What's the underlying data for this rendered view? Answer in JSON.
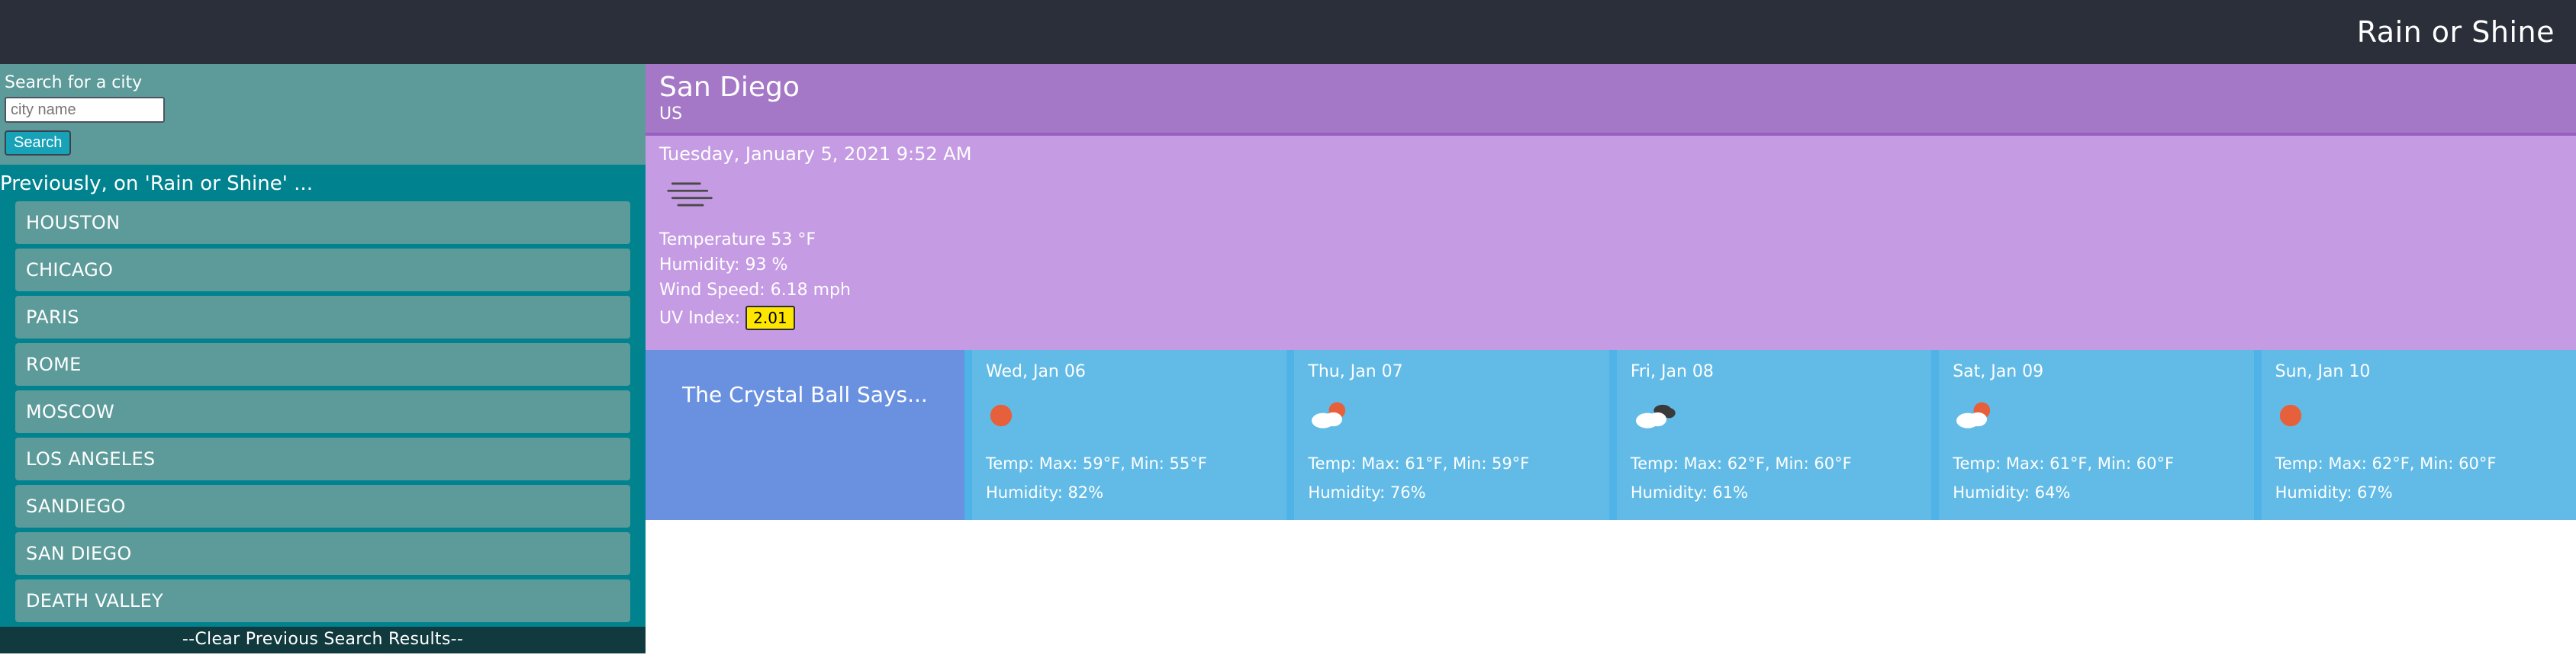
{
  "app": {
    "title": "Rain or Shine"
  },
  "sidebar": {
    "search_label": "Search for a city",
    "placeholder": "city name",
    "search_button": "Search",
    "history_title": "Previously, on 'Rain or Shine' ...",
    "history": [
      "HOUSTON",
      "CHICAGO",
      "PARIS",
      "ROME",
      "MOSCOW",
      "LOS ANGELES",
      "SANDIEGO",
      "SAN DIEGO",
      "DEATH VALLEY"
    ],
    "clear_label": "--Clear Previous Search Results--"
  },
  "current": {
    "city": "San Diego",
    "country": "US",
    "date": "Tuesday, January 5, 2021 9:52 AM",
    "temp_label": "Temperature 53 °F",
    "humidity_label": "Humidity: 93 %",
    "wind_label": "Wind Speed: 6.18 mph",
    "uv_prefix": "UV Index: ",
    "uv_value": "2.01",
    "icon": "fog-icon"
  },
  "forecast": {
    "heading": "The Crystal Ball Says...",
    "days": [
      {
        "date": "Wed, Jan 06",
        "icon": "sun-icon",
        "temp": "Temp: Max: 59°F, Min: 55°F",
        "humidity": "Humidity: 82%"
      },
      {
        "date": "Thu, Jan 07",
        "icon": "sun-cloud-icon",
        "temp": "Temp: Max: 61°F, Min: 59°F",
        "humidity": "Humidity: 76%"
      },
      {
        "date": "Fri, Jan 08",
        "icon": "clouds-icon",
        "temp": "Temp: Max: 62°F, Min: 60°F",
        "humidity": "Humidity: 61%"
      },
      {
        "date": "Sat, Jan 09",
        "icon": "sun-cloud-icon",
        "temp": "Temp: Max: 61°F, Min: 60°F",
        "humidity": "Humidity: 64%"
      },
      {
        "date": "Sun, Jan 10",
        "icon": "sun-icon",
        "temp": "Temp: Max: 62°F, Min: 60°F",
        "humidity": "Humidity: 67%"
      }
    ]
  }
}
